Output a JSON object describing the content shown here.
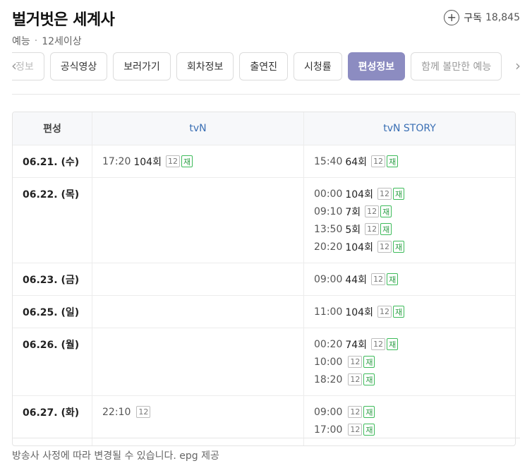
{
  "header": {
    "title": "벌거벗은 세계사",
    "genre": "예능",
    "rating": "12세이상",
    "subscribe_label": "구독",
    "subscribe_count": "18,845"
  },
  "tabs": [
    {
      "label": "정보",
      "partial": true
    },
    {
      "label": "공식영상"
    },
    {
      "label": "보러가기"
    },
    {
      "label": "회차정보"
    },
    {
      "label": "출연진"
    },
    {
      "label": "시청률"
    },
    {
      "label": "편성정보",
      "active": true
    },
    {
      "label": "함께 볼만한 예능",
      "faded": true
    }
  ],
  "table": {
    "headers": {
      "date": "편성",
      "tvn": "tvN",
      "story": "tvN STORY"
    },
    "badge_rating": "12",
    "badge_rerun": "재",
    "rows": [
      {
        "date": "06.21. (수)",
        "tvn": [
          {
            "time": "17:20",
            "ep": "104회",
            "rating": true,
            "rerun": true
          }
        ],
        "story": [
          {
            "time": "15:40",
            "ep": "64회",
            "rating": true,
            "rerun": true
          }
        ]
      },
      {
        "date": "06.22. (목)",
        "tvn": [],
        "story": [
          {
            "time": "00:00",
            "ep": "104회",
            "rating": true,
            "rerun": true
          },
          {
            "time": "09:10",
            "ep": "7회",
            "rating": true,
            "rerun": true
          },
          {
            "time": "13:50",
            "ep": "5회",
            "rating": true,
            "rerun": true
          },
          {
            "time": "20:20",
            "ep": "104회",
            "rating": true,
            "rerun": true
          }
        ]
      },
      {
        "date": "06.23. (금)",
        "tvn": [],
        "story": [
          {
            "time": "09:00",
            "ep": "44회",
            "rating": true,
            "rerun": true
          }
        ]
      },
      {
        "date": "06.25. (일)",
        "tvn": [],
        "story": [
          {
            "time": "11:00",
            "ep": "104회",
            "rating": true,
            "rerun": true
          }
        ]
      },
      {
        "date": "06.26. (월)",
        "tvn": [],
        "story": [
          {
            "time": "00:20",
            "ep": "74회",
            "rating": true,
            "rerun": true
          },
          {
            "time": "10:00",
            "ep": "",
            "rating": true,
            "rerun": true
          },
          {
            "time": "18:20",
            "ep": "",
            "rating": true,
            "rerun": true
          }
        ]
      },
      {
        "date": "06.27. (화)",
        "tvn": [
          {
            "time": "22:10",
            "ep": "",
            "rating": true,
            "rerun": false
          }
        ],
        "story": [
          {
            "time": "09:00",
            "ep": "",
            "rating": true,
            "rerun": true
          },
          {
            "time": "17:00",
            "ep": "",
            "rating": true,
            "rerun": true
          }
        ]
      }
    ]
  },
  "footer": {
    "note": "방송사 사정에 따라 변경될 수 있습니다. epg 제공"
  },
  "colors": {
    "active_tab": "#8c8cc1",
    "channel_header": "#3a6fb4",
    "rerun_badge": "#3dbb5a"
  }
}
